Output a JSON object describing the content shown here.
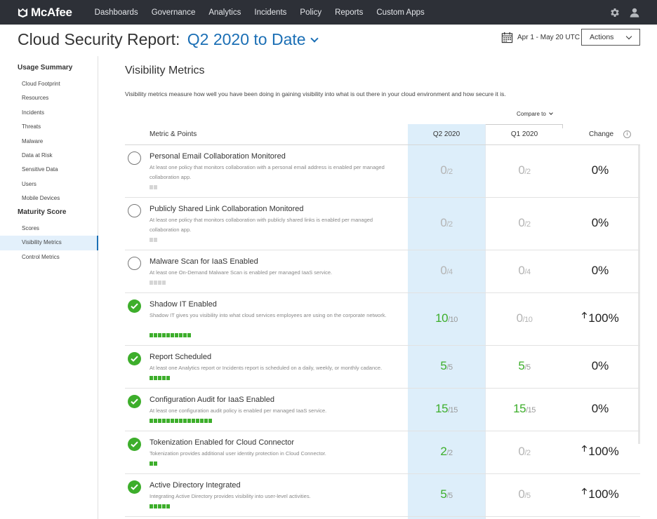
{
  "brand": {
    "logo_text": "McAfee"
  },
  "nav": [
    "Dashboards",
    "Governance",
    "Analytics",
    "Incidents",
    "Policy",
    "Reports",
    "Custom Apps"
  ],
  "header": {
    "title": "Cloud Security Report:",
    "period": "Q2 2020 to Date",
    "date_range": "Apr 1 - May 20 UTC",
    "actions_label": "Actions"
  },
  "sidebar": {
    "sections": [
      {
        "title": "Usage Summary",
        "items": [
          "Cloud Footprint",
          "Resources",
          "Incidents",
          "Threats",
          "Malware",
          "Data at Risk",
          "Sensitive Data",
          "Users",
          "Mobile Devices"
        ]
      },
      {
        "title": "Maturity Score",
        "items": [
          "Scores",
          "Visibility Metrics",
          "Control Metrics"
        ]
      }
    ],
    "active_item": "Visibility Metrics"
  },
  "main": {
    "title": "Visibility Metrics",
    "description": "Visibility metrics measure how well you have been doing in gaining visibility into what is out there in your cloud environment and how secure it is.",
    "compare_label": "Compare to",
    "columns": {
      "metric": "Metric & Points",
      "current": "Q2 2020",
      "previous": "Q1 2020",
      "change": "Change",
      "info_icon": "i"
    }
  },
  "metrics": [
    {
      "name": "Personal Email Collaboration Monitored",
      "description": "At least one policy that monitors collaboration with a personal email address is enabled per managed collaboration app.",
      "enabled": false,
      "max": 2,
      "q2": 0,
      "q2_max": "/2",
      "q1": 0,
      "q1_max": "/2",
      "change": "0%"
    },
    {
      "name": "Publicly Shared Link Collaboration Monitored",
      "description": "At least one policy that monitors collaboration with publicly shared links is enabled per managed collaboration app.",
      "enabled": false,
      "max": 2,
      "q2": 0,
      "q2_max": "/2",
      "q1": 0,
      "q1_max": "/2",
      "change": "0%"
    },
    {
      "name": "Malware Scan for IaaS Enabled",
      "description": "At least one On-Demand Malware Scan is enabled per managed IaaS service.",
      "enabled": false,
      "max": 4,
      "q2": 0,
      "q2_max": "/4",
      "q1": 0,
      "q1_max": "/4",
      "change": "0%"
    },
    {
      "name": "Shadow IT Enabled",
      "description": "Shadow IT gives you visibility into what cloud services employees are using on the corporate network.",
      "enabled": true,
      "max": 10,
      "q2": 10,
      "q2_max": "/10",
      "q1": 0,
      "q1_max": "/10",
      "change": "100%"
    },
    {
      "name": "Report Scheduled",
      "description": "At least one Analytics report or Incidents report is scheduled on a daily, weekly, or monthly cadance.",
      "enabled": true,
      "max": 5,
      "q2": 5,
      "q2_max": "/5",
      "q1": 5,
      "q1_max": "/5",
      "change": "0%"
    },
    {
      "name": "Configuration Audit for IaaS Enabled",
      "description": "At least one configuration audit policy is enabled per managed IaaS service.",
      "enabled": true,
      "max": 15,
      "q2": 15,
      "q2_max": "/15",
      "q1": 15,
      "q1_max": "/15",
      "change": "0%"
    },
    {
      "name": "Tokenization Enabled for Cloud Connector",
      "description": "Tokenization provides additional user identity protection in Cloud Connector.",
      "enabled": true,
      "max": 2,
      "q2": 2,
      "q2_max": "/2",
      "q1": 0,
      "q1_max": "/2",
      "change": "100%"
    },
    {
      "name": "Active Directory Integrated",
      "description": "Integrating Active Directory provides visibility into user-level activities.",
      "enabled": true,
      "max": 5,
      "q2": 5,
      "q2_max": "/5",
      "q1": 0,
      "q1_max": "/5",
      "change": "100%"
    }
  ],
  "colors": {
    "nav_bg": "#2d3037",
    "accent_blue": "#1b6fb5",
    "highlight_column": "#ddeefa",
    "success_green": "#3dae2b",
    "muted_grey": "#b4b4b4"
  },
  "icons": {
    "settings": "gear-icon",
    "user": "user-icon",
    "calendar": "calendar-icon",
    "enabled": "check-circle-icon",
    "disabled": "empty-circle-icon",
    "increase": "arrow-up-icon"
  }
}
